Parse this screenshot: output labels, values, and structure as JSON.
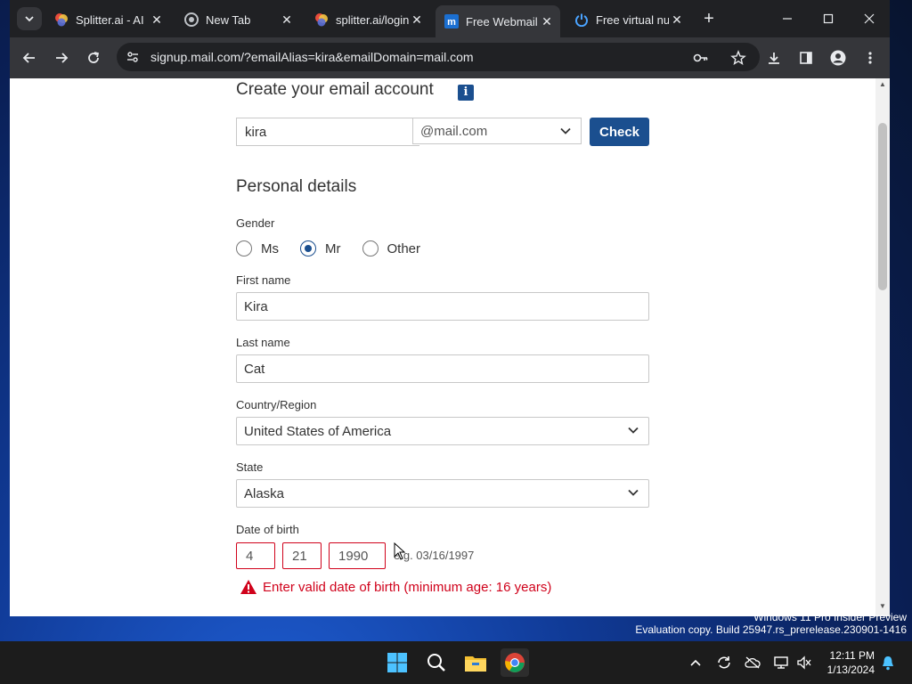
{
  "browser": {
    "tabs": [
      {
        "title": "Splitter.ai - AI",
        "icon": "splitter-favicon"
      },
      {
        "title": "New Tab",
        "icon": "chrome-favicon"
      },
      {
        "title": "splitter.ai/login",
        "icon": "splitter-favicon"
      },
      {
        "title": "Free Webmail",
        "icon": "mail-com-favicon",
        "active": true
      },
      {
        "title": "Free virtual nu",
        "icon": "power-favicon"
      }
    ],
    "url": "signup.mail.com/?emailAlias=kira&emailDomain=mail.com"
  },
  "form": {
    "heading": "Create your email account",
    "info_glyph": "i",
    "alias_value": "kira",
    "domain_value": "@mail.com",
    "check_label": "Check",
    "personal_heading": "Personal details",
    "gender_label": "Gender",
    "gender_options": [
      "Ms",
      "Mr",
      "Other"
    ],
    "gender_selected": "Mr",
    "first_name_label": "First name",
    "first_name_value": "Kira",
    "last_name_label": "Last name",
    "last_name_value": "Cat",
    "country_label": "Country/Region",
    "country_value": "United States of America",
    "state_label": "State",
    "state_value": "Alaska",
    "dob_label": "Date of birth",
    "dob_month": "4",
    "dob_day": "21",
    "dob_year": "1990",
    "dob_hint": "e.g. 03/16/1997",
    "dob_error": "Enter valid date of birth (minimum age: 16 years)",
    "error_color": "#d0021b",
    "accent_color": "#1b4f8f"
  },
  "desktop": {
    "watermark_line1": "Windows 11 Pro Insider Preview",
    "watermark_line2": "Evaluation copy. Build 25947.rs_prerelease.230901-1416"
  },
  "taskbar": {
    "time": "12:11 PM",
    "date": "1/13/2024"
  }
}
